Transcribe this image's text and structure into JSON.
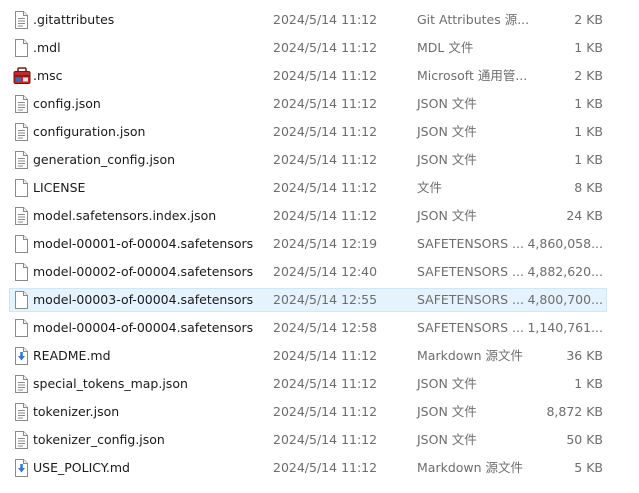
{
  "files": [
    {
      "name": ".gitattributes",
      "date": "2024/5/14 11:12",
      "type": "Git Attributes 源...",
      "size": "2 KB",
      "icon": "doc-icon"
    },
    {
      "name": ".mdl",
      "date": "2024/5/14 11:12",
      "type": "MDL 文件",
      "size": "1 KB",
      "icon": "blank-file-icon"
    },
    {
      "name": ".msc",
      "date": "2024/5/14 11:12",
      "type": "Microsoft 通用管...",
      "size": "2 KB",
      "icon": "toolbox-icon"
    },
    {
      "name": "config.json",
      "date": "2024/5/14 11:12",
      "type": "JSON 文件",
      "size": "1 KB",
      "icon": "doc-icon"
    },
    {
      "name": "configuration.json",
      "date": "2024/5/14 11:12",
      "type": "JSON 文件",
      "size": "1 KB",
      "icon": "doc-icon"
    },
    {
      "name": "generation_config.json",
      "date": "2024/5/14 11:12",
      "type": "JSON 文件",
      "size": "1 KB",
      "icon": "doc-icon"
    },
    {
      "name": "LICENSE",
      "date": "2024/5/14 11:12",
      "type": "文件",
      "size": "8 KB",
      "icon": "blank-file-icon"
    },
    {
      "name": "model.safetensors.index.json",
      "date": "2024/5/14 11:12",
      "type": "JSON 文件",
      "size": "24 KB",
      "icon": "doc-icon"
    },
    {
      "name": "model-00001-of-00004.safetensors",
      "date": "2024/5/14 12:19",
      "type": "SAFETENSORS ...",
      "size": "4,860,058...",
      "icon": "blank-file-icon"
    },
    {
      "name": "model-00002-of-00004.safetensors",
      "date": "2024/5/14 12:40",
      "type": "SAFETENSORS ...",
      "size": "4,882,620...",
      "icon": "blank-file-icon"
    },
    {
      "name": "model-00003-of-00004.safetensors",
      "date": "2024/5/14 12:55",
      "type": "SAFETENSORS ...",
      "size": "4,800,700...",
      "icon": "blank-file-icon",
      "selected": true
    },
    {
      "name": "model-00004-of-00004.safetensors",
      "date": "2024/5/14 12:58",
      "type": "SAFETENSORS ...",
      "size": "1,140,761...",
      "icon": "blank-file-icon"
    },
    {
      "name": "README.md",
      "date": "2024/5/14 11:12",
      "type": "Markdown 源文件",
      "size": "36 KB",
      "icon": "markdown-file-icon"
    },
    {
      "name": "special_tokens_map.json",
      "date": "2024/5/14 11:12",
      "type": "JSON 文件",
      "size": "1 KB",
      "icon": "doc-icon"
    },
    {
      "name": "tokenizer.json",
      "date": "2024/5/14 11:12",
      "type": "JSON 文件",
      "size": "8,872 KB",
      "icon": "doc-icon"
    },
    {
      "name": "tokenizer_config.json",
      "date": "2024/5/14 11:12",
      "type": "JSON 文件",
      "size": "50 KB",
      "icon": "doc-icon"
    },
    {
      "name": "USE_POLICY.md",
      "date": "2024/5/14 11:12",
      "type": "Markdown 源文件",
      "size": "5 KB",
      "icon": "markdown-file-icon"
    }
  ],
  "colors": {
    "selection_bg": "#e5f3ff",
    "selection_border": "#cce8ff",
    "text": "#1a1a1a",
    "secondary_text": "#6d6d6d"
  }
}
